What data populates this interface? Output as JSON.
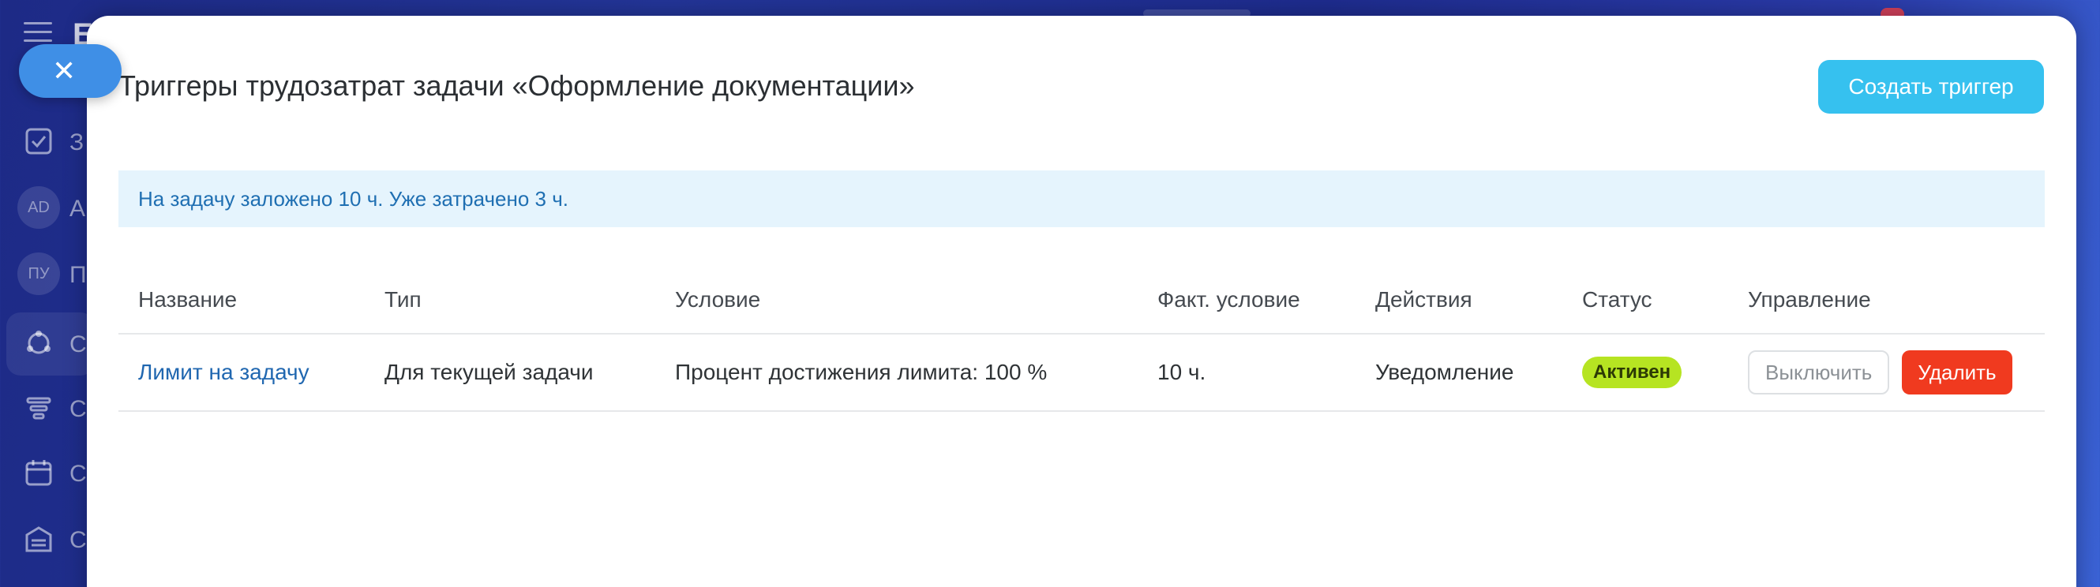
{
  "background": {
    "logo_letter": "Б",
    "sidebar_items": [
      {
        "icon": "checkbox-icon",
        "letter": "З"
      },
      {
        "icon": "avatar",
        "avatar_text": "AD",
        "letter": "А"
      },
      {
        "icon": "avatar",
        "avatar_text": "ПУ",
        "letter": "П"
      },
      {
        "icon": "network-icon",
        "letter": "С"
      },
      {
        "icon": "filter-icon",
        "letter": "С"
      },
      {
        "icon": "calendar-icon",
        "letter": "С"
      },
      {
        "icon": "warehouse-icon",
        "letter": "С"
      }
    ]
  },
  "modal": {
    "title": "Триггеры трудозатрат задачи «Оформление документации»",
    "create_button": "Создать триггер",
    "info": "На задачу заложено 10 ч. Уже затрачено 3 ч.",
    "table": {
      "columns": [
        "Название",
        "Тип",
        "Условие",
        "Факт. условие",
        "Действия",
        "Статус",
        "Управление"
      ],
      "rows": [
        {
          "name": "Лимит на задачу",
          "type": "Для текущей задачи",
          "condition": "Процент достижения лимита: 100 %",
          "actual": "10 ч.",
          "action": "Уведомление",
          "status": "Активен",
          "disable_label": "Выключить",
          "delete_label": "Удалить"
        }
      ]
    }
  },
  "colors": {
    "accent": "#36c1ef",
    "link": "#2067b0",
    "status_active": "#b6e422",
    "danger": "#f03a1f",
    "info_bg": "#e5f4fd"
  }
}
